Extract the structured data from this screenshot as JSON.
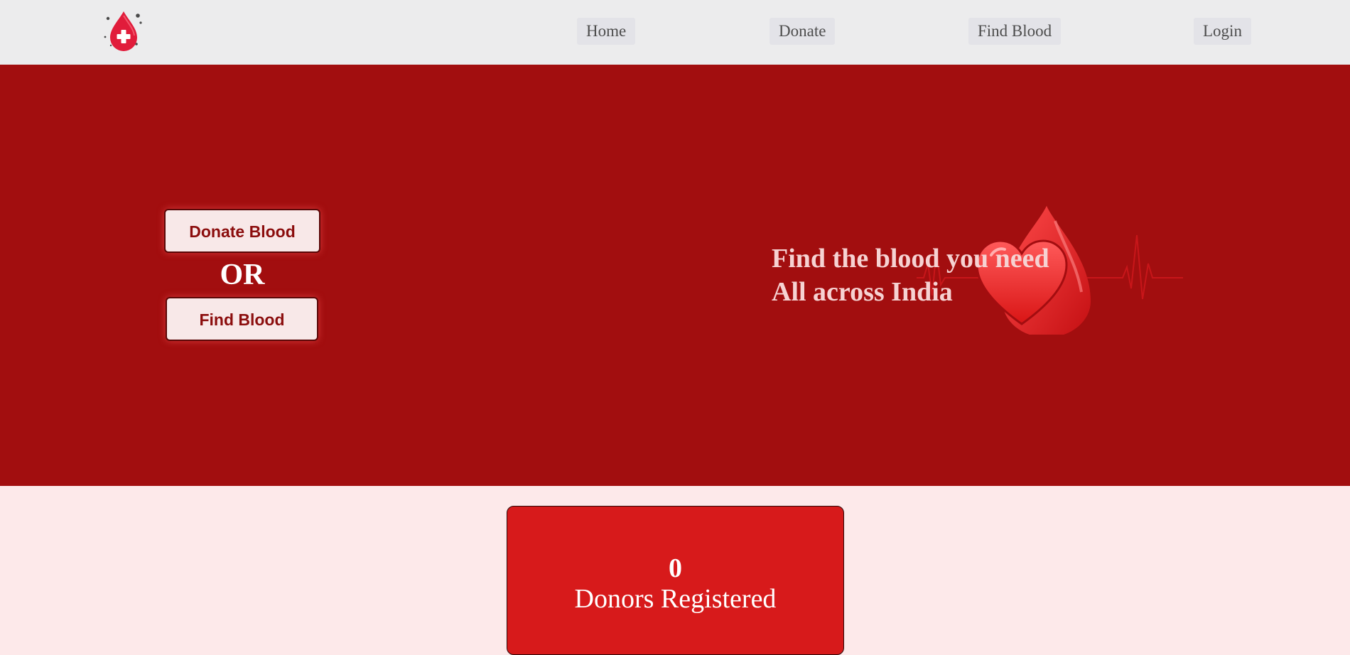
{
  "colors": {
    "navbar_bg": "#ececed",
    "hero_bg": "#a20e0f",
    "page_bg": "#fde9ea",
    "stats_card_bg": "#d71a1b",
    "button_text": "#8b0d0d",
    "tagline": "#f6d2d2"
  },
  "navbar": {
    "logo_icon": "blood-drop-plus-icon",
    "links": [
      {
        "label": "Home"
      },
      {
        "label": "Donate"
      },
      {
        "label": "Find Blood"
      },
      {
        "label": "Login"
      }
    ]
  },
  "hero": {
    "donate_button": "Donate Blood",
    "or_text": "OR",
    "find_button": "Find Blood",
    "tagline_line1": "Find the blood you need",
    "tagline_line2": "All across India",
    "art_icon": "blood-drop-heart-heartbeat-icon"
  },
  "stats": {
    "donor_count": "0",
    "donor_label": "Donors Registered"
  }
}
